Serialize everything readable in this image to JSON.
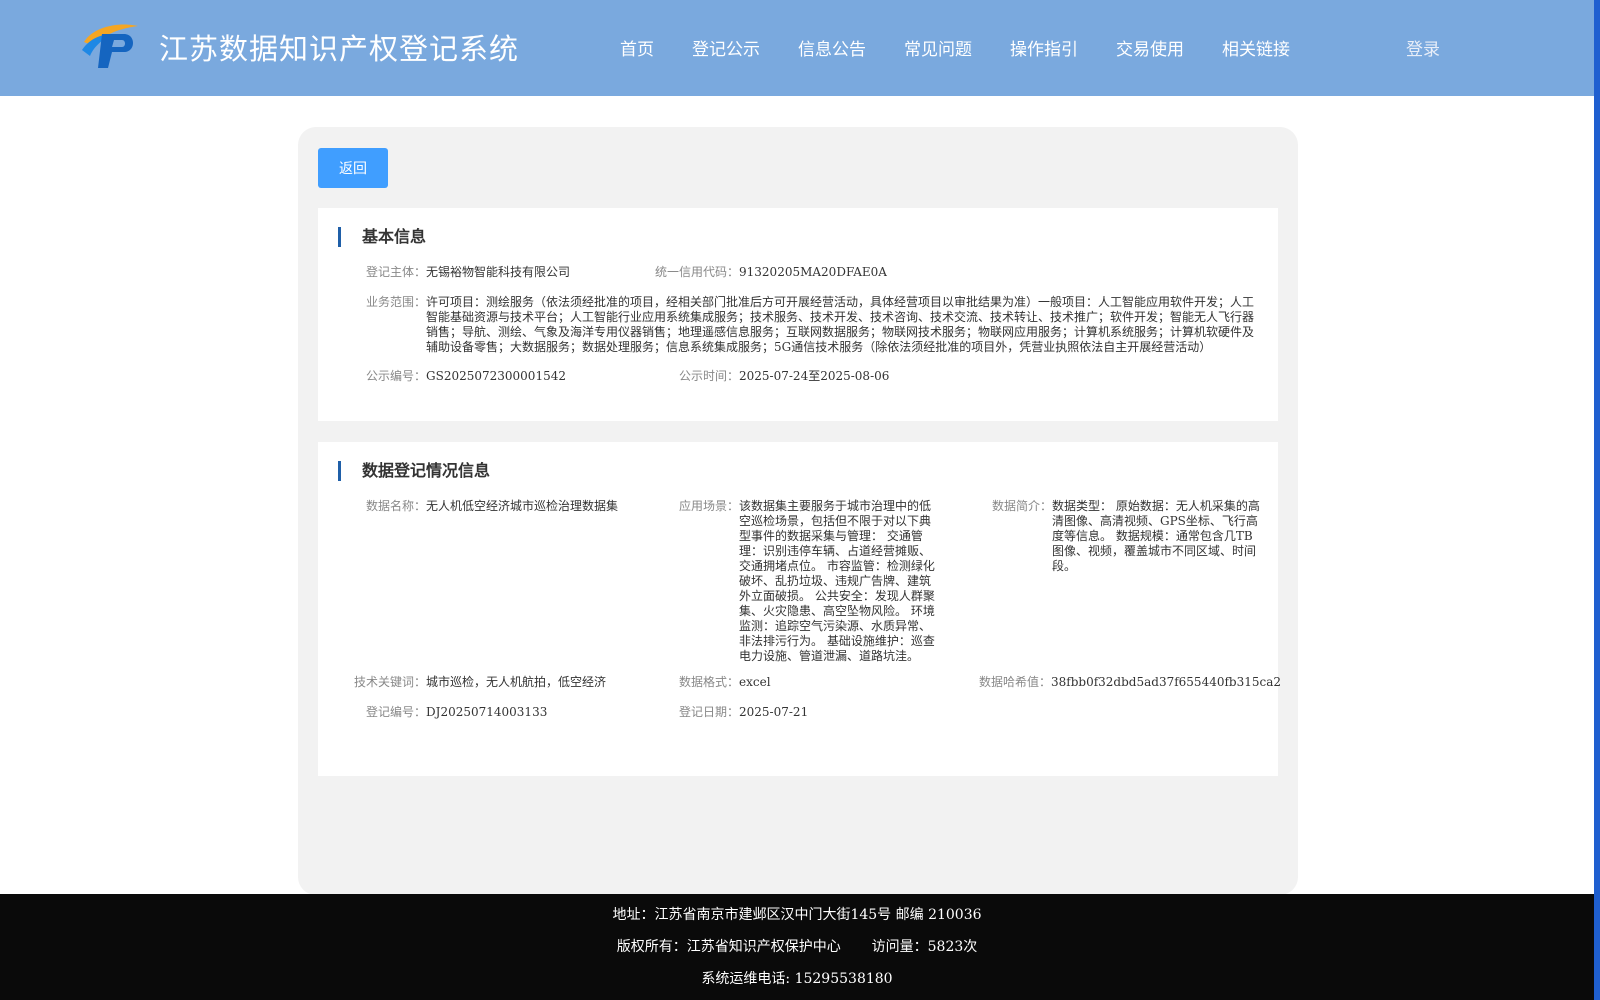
{
  "header": {
    "title": "江苏数据知识产权登记系统",
    "nav": [
      "首页",
      "登记公示",
      "信息公告",
      "常见问题",
      "操作指引",
      "交易使用",
      "相关链接"
    ],
    "login": "登录"
  },
  "back_button": "返回",
  "basic_info": {
    "title": "基本信息",
    "subject_label": "登记主体：",
    "subject_value": "无锡裕物智能科技有限公司",
    "credit_label": "统一信用代码：",
    "credit_value": "91320205MA20DFAE0A",
    "scope_label": "业务范围：",
    "scope_value": "许可项目：测绘服务（依法须经批准的项目，经相关部门批准后方可开展经营活动，具体经营项目以审批结果为准）一般项目：人工智能应用软件开发；人工智能基础资源与技术平台；人工智能行业应用系统集成服务；技术服务、技术开发、技术咨询、技术交流、技术转让、技术推广；软件开发；智能无人飞行器销售；导航、测绘、气象及海洋专用仪器销售；地理遥感信息服务；互联网数据服务；物联网技术服务；物联网应用服务；计算机系统服务；计算机软硬件及辅助设备零售；大数据服务；数据处理服务；信息系统集成服务；5G通信技术服务（除依法须经批准的项目外，凭营业执照依法自主开展经营活动）",
    "pub_no_label": "公示编号：",
    "pub_no_value": "GS2025072300001542",
    "pub_time_label": "公示时间：",
    "pub_time_value": "2025-07-24至2025-08-06"
  },
  "data_info": {
    "title": "数据登记情况信息",
    "name_label": "数据名称：",
    "name_value": "无人机低空经济城市巡检治理数据集",
    "scene_label": "应用场景：",
    "scene_value": "该数据集主要服务于城市治理中的低空巡检场景，包括但不限于对以下典型事件的数据采集与管理： 交通管理：识别违停车辆、占道经营摊贩、交通拥堵点位。 市容监管：检测绿化破坏、乱扔垃圾、违规广告牌、建筑外立面破损。 公共安全：发现人群聚集、火灾隐患、高空坠物风险。 环境监测：追踪空气污染源、水质异常、非法排污行为。 基础设施维护：巡查电力设施、管道泄漏、道路坑洼。",
    "intro_label": "数据简介：",
    "intro_value": "数据类型： 原始数据：无人机采集的高清图像、高清视频、GPS坐标、飞行高度等信息。 数据规模：通常包含几TB图像、视频，覆盖城市不同区域、时间段。",
    "keywords_label": "技术关键词：",
    "keywords_value": "城市巡检，无人机航拍，低空经济",
    "format_label": "数据格式：",
    "format_value": "excel",
    "hash_label": "数据哈希值：",
    "hash_value": "38fbb0f32dbd5ad37f655440fb315ca2",
    "reg_no_label": "登记编号：",
    "reg_no_value": "DJ20250714003133",
    "reg_date_label": "登记日期：",
    "reg_date_value": "2025-07-21"
  },
  "footer": {
    "address": "地址：江苏省南京市建邺区汉中门大街145号 邮编 210036",
    "copyright": "版权所有：江苏省知识产权保护中心",
    "visits": "访问量：5823次",
    "phone": "系统运维电话: 15295538180"
  },
  "colors": {
    "header_bg": "#7aa9de",
    "accent": "#409eff",
    "title_bar": "#1f5fa8",
    "footer_bg": "#0a0a0a"
  }
}
